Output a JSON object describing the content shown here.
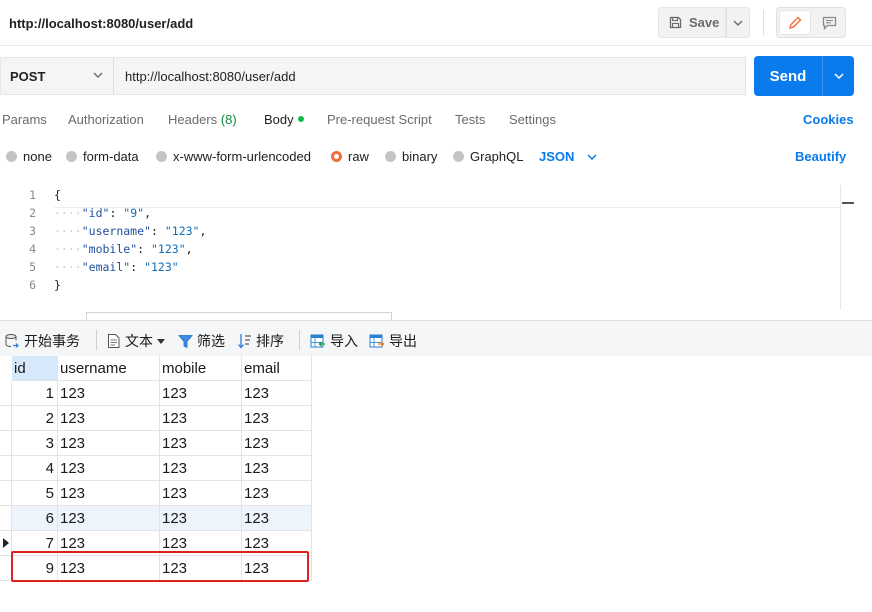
{
  "postman": {
    "title": "http://localhost:8080/user/add",
    "save_label": "Save",
    "method": "POST",
    "url": "http://localhost:8080/user/add",
    "send_label": "Send",
    "tabs": [
      {
        "label": "Params"
      },
      {
        "label": "Authorization"
      },
      {
        "label": "Headers",
        "count": "(8)"
      },
      {
        "label": "Body"
      },
      {
        "label": "Pre-request Script"
      },
      {
        "label": "Tests"
      },
      {
        "label": "Settings"
      }
    ],
    "cookies_label": "Cookies",
    "body_types": [
      "none",
      "form-data",
      "x-www-form-urlencoded",
      "raw",
      "binary",
      "GraphQL"
    ],
    "selected_body_type": "raw",
    "format": "JSON",
    "beautify_label": "Beautify",
    "editor": {
      "line_numbers": [
        "1",
        "2",
        "3",
        "4",
        "5",
        "6"
      ],
      "lines": [
        {
          "key": "id",
          "value": "9"
        },
        {
          "key": "username",
          "value": "123"
        },
        {
          "key": "mobile",
          "value": "123"
        },
        {
          "key": "email",
          "value": "123"
        }
      ]
    }
  },
  "navicat": {
    "toolbar": {
      "begin_transaction": "开始事务",
      "text": "文本",
      "filter": "筛选",
      "sort": "排序",
      "import": "导入",
      "export": "导出"
    },
    "columns": [
      "id",
      "username",
      "mobile",
      "email"
    ],
    "rows": [
      [
        "1",
        "123",
        "123",
        "123"
      ],
      [
        "2",
        "123",
        "123",
        "123"
      ],
      [
        "3",
        "123",
        "123",
        "123"
      ],
      [
        "4",
        "123",
        "123",
        "123"
      ],
      [
        "5",
        "123",
        "123",
        "123"
      ],
      [
        "6",
        "123",
        "123",
        "123"
      ],
      [
        "7",
        "123",
        "123",
        "123"
      ],
      [
        "9",
        "123",
        "123",
        "123"
      ]
    ],
    "highlight_color": "#e32020"
  },
  "colors": {
    "accent": "#097bed",
    "radio_selected": "#f26b3a",
    "body_dot": "#0cbb52"
  }
}
